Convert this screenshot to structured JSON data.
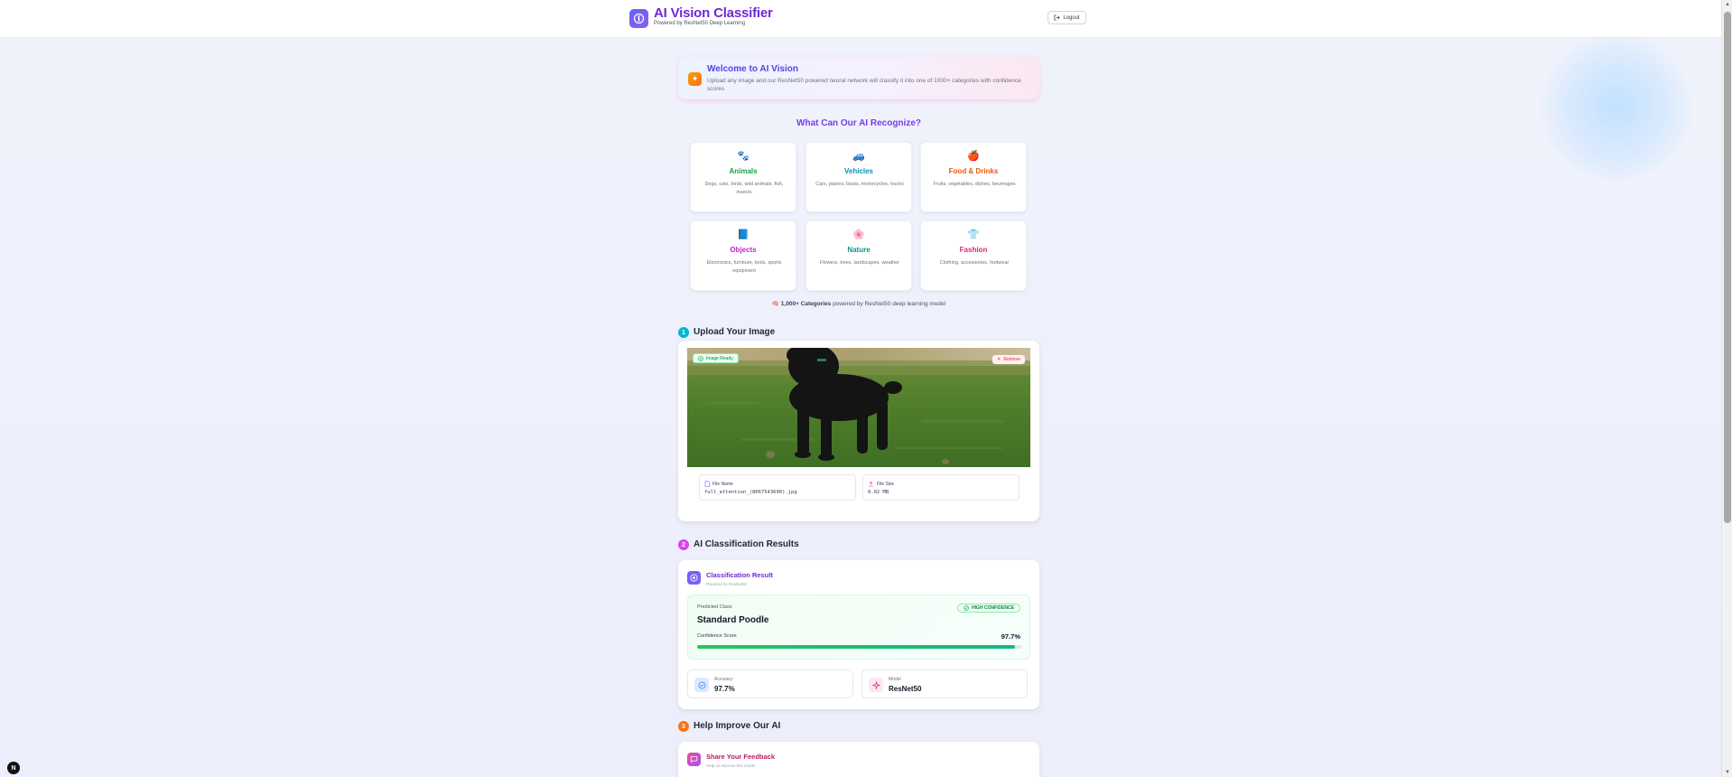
{
  "header": {
    "title": "AI Vision Classifier",
    "subtitle": "Powered by ResNet50 Deep Learning",
    "logout_label": "Logout"
  },
  "welcome": {
    "title": "Welcome to AI Vision",
    "text": "Upload any image and our ResNet50 powered neural network will classify it into one of 1000+ categories with confidence scores"
  },
  "recognize": {
    "heading": "What Can Our AI Recognize?",
    "categories": [
      {
        "icon": "🐾",
        "title": "Animals",
        "desc": "Dogs, cats, birds, wild animals, fish, insects",
        "color": "#16a34a"
      },
      {
        "icon": "🚙",
        "title": "Vehicles",
        "desc": "Cars, planes, boats, motorcycles, trucks",
        "color": "#0891b2"
      },
      {
        "icon": "🍎",
        "title": "Food & Drinks",
        "desc": "Fruits, vegetables, dishes, beverages",
        "color": "#ea580c"
      },
      {
        "icon": "📘",
        "title": "Objects",
        "desc": "Electronics, furniture, tools, sports equipment",
        "color": "#c026d3"
      },
      {
        "icon": "🌸",
        "title": "Nature",
        "desc": "Flowers, trees, landscapes, weather",
        "color": "#0d9488"
      },
      {
        "icon": "👕",
        "title": "Fashion",
        "desc": "Clothing, accessories, footwear",
        "color": "#db2777"
      }
    ],
    "note_icon": "🧠",
    "note_bold": "1,000+ Categories",
    "note_rest": " powered by ResNet50 deep learning model"
  },
  "upload": {
    "step": "1",
    "title": "Upload Your Image",
    "ready_label": "Image Ready",
    "remove_label": "Remove",
    "file_name_label": "File Name",
    "file_name": "full_attention_(8067543690).jpg",
    "file_size_label": "File Size",
    "file_size": "0.02 MB"
  },
  "results": {
    "step": "2",
    "title": "AI Classification Results",
    "card_title": "Classification Result",
    "card_sub": "Powered by ResNet50",
    "predicted_label": "Predicted Class",
    "predicted_class": "Standard Poodle",
    "confidence_badge": "HIGH CONFIDENCE",
    "confidence_label": "Confidence Score",
    "confidence_value": "97.7%",
    "confidence_fraction": 0.977,
    "accuracy_label": "Accuracy",
    "accuracy_value": "97.7%",
    "model_label": "Model",
    "model_value": "ResNet50"
  },
  "feedback": {
    "step": "3",
    "title": "Help Improve Our AI",
    "card_title": "Share Your Feedback",
    "card_sub": "Help us improve this model"
  },
  "dev_badge": "N",
  "colors": {
    "accent": "#7c3aed",
    "success": "#22c55e",
    "step1": "#06b6d4",
    "step2": "#d946ef",
    "step3": "#f97316"
  }
}
